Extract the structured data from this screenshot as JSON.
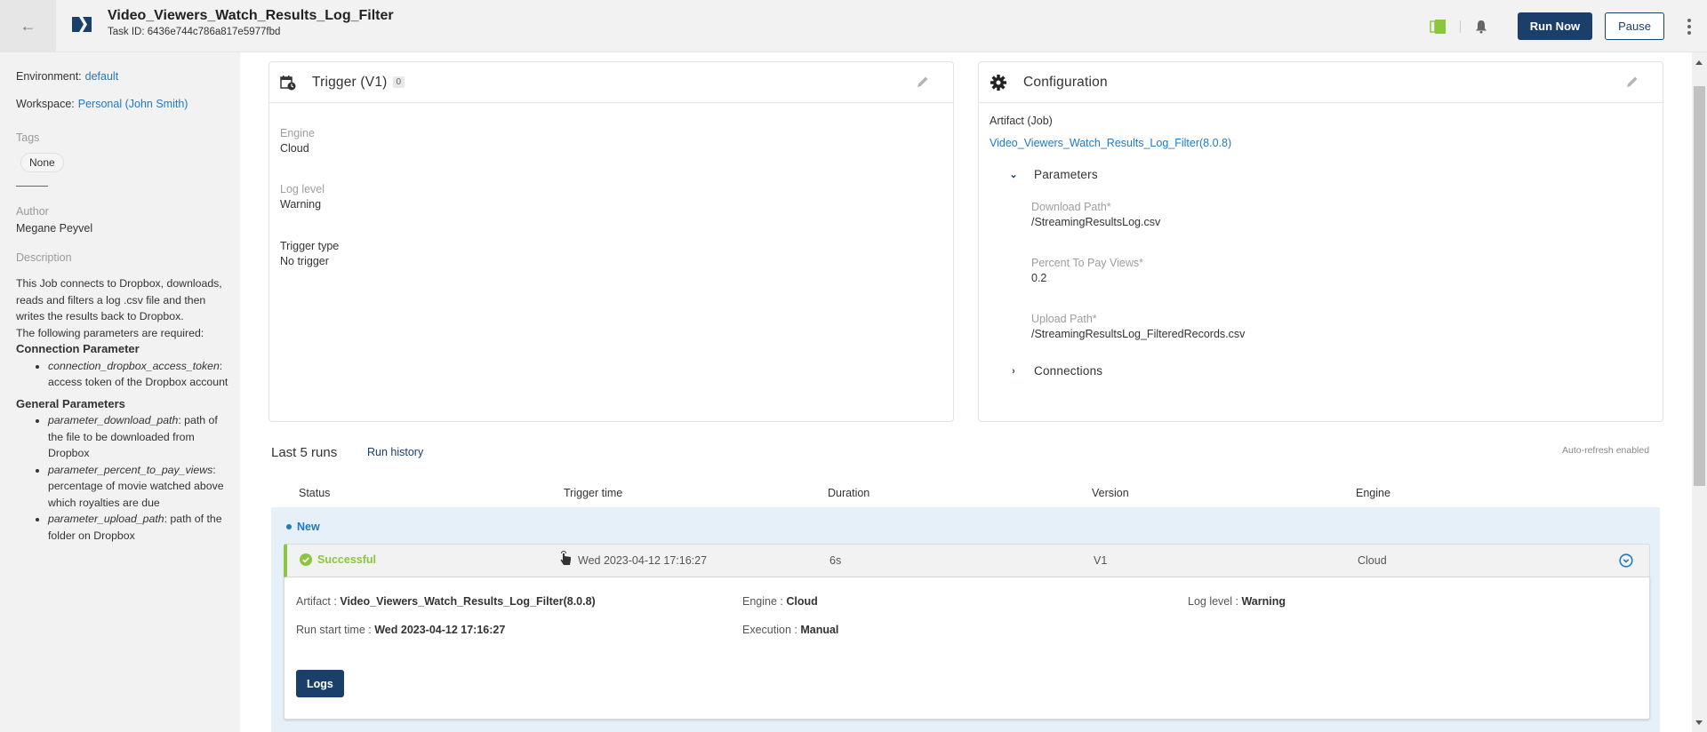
{
  "header": {
    "title": "Video_Viewers_Watch_Results_Log_Filter",
    "task_id": "Task ID: 6436e744c786a817e5977fbd",
    "run_now_label": "Run Now",
    "pause_label": "Pause",
    "icons": [
      "back-arrow-icon",
      "app-logo-icon",
      "book-icon",
      "bell-icon",
      "kebab-menu-icon"
    ]
  },
  "sidebar": {
    "environment_label": "Environment:",
    "environment_value": "default",
    "workspace_label": "Workspace:",
    "workspace_value": "Personal (John Smith)",
    "tags_label": "Tags",
    "tags": [
      "None"
    ],
    "author_label": "Author",
    "author_value": "Megane Peyvel",
    "description_label": "Description",
    "description": {
      "intro": "This Job connects to Dropbox, downloads, reads and filters a log .csv file and then writes the results back to Dropbox.",
      "required": "The following parameters are required:",
      "connection_heading": "Connection Parameter",
      "connection_params": [
        {
          "name": "connection_dropbox_access_token",
          "text": ": access token of the Dropbox account"
        }
      ],
      "general_heading": "General Parameters",
      "general_params": [
        {
          "name": "parameter_download_path",
          "text": ": path of the file to be downloaded from Dropbox"
        },
        {
          "name": "parameter_percent_to_pay_views",
          "text": ": percentage of movie watched above which royalties are due"
        },
        {
          "name": "parameter_upload_path",
          "text": ": path of the folder on Dropbox"
        }
      ]
    }
  },
  "trigger_card": {
    "title": "Trigger (V1)",
    "badge": "0",
    "fields": [
      {
        "label": "Engine",
        "value": "Cloud"
      },
      {
        "label": "Log level",
        "value": "Warning"
      },
      {
        "label": "Trigger type",
        "value": "No trigger"
      }
    ]
  },
  "config_card": {
    "title": "Configuration",
    "artifact_label": "Artifact (Job)",
    "artifact_value": "Video_Viewers_Watch_Results_Log_Filter(8.0.8)",
    "parameters_label": "Parameters",
    "parameters": [
      {
        "label": "Download Path*",
        "value": "/StreamingResultsLog.csv"
      },
      {
        "label": "Percent To Pay Views*",
        "value": "0.2"
      },
      {
        "label": "Upload Path*",
        "value": "/StreamingResultsLog_FilteredRecords.csv"
      }
    ],
    "connections_label": "Connections"
  },
  "runs": {
    "title": "Last 5 runs",
    "history_link": "Run history",
    "auto_refresh": "Auto-refresh enabled",
    "columns": [
      "Status",
      "Trigger time",
      "Duration",
      "Version",
      "Engine"
    ],
    "group_label": "New",
    "rows": [
      {
        "status": "Successful",
        "trigger_time": "Wed 2023-04-12 17:16:27",
        "duration": "6s",
        "version": "V1",
        "engine": "Cloud",
        "details": {
          "artifact_label": "Artifact :",
          "artifact_value": "Video_Viewers_Watch_Results_Log_Filter(8.0.8)",
          "engine_label": "Engine :",
          "engine_value": "Cloud",
          "log_level_label": "Log level :",
          "log_level_value": "Warning",
          "run_start_label": "Run start time :",
          "run_start_value": "Wed 2023-04-12 17:16:27",
          "execution_label": "Execution :",
          "execution_value": "Manual",
          "logs_button": "Logs"
        }
      }
    ]
  },
  "colors": {
    "primary": "#1b3f6b",
    "link": "#1f7ac1",
    "success": "#8cc63f",
    "runs_bg": "#e6f0f9"
  }
}
